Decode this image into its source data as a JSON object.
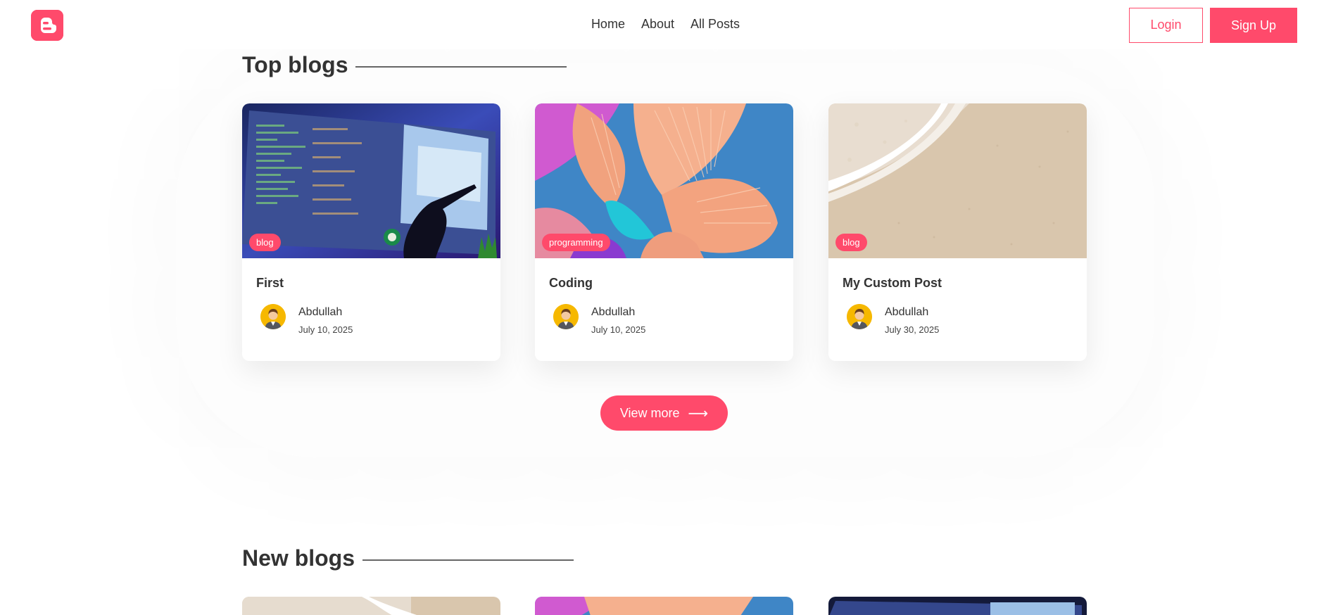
{
  "nav": {
    "links": [
      "Home",
      "About",
      "All Posts"
    ],
    "login_label": "Login",
    "signup_label": "Sign Up"
  },
  "sections": {
    "top_title": "Top blogs",
    "new_title": "New blogs"
  },
  "top_posts": [
    {
      "category": "blog",
      "title": "First",
      "author": "Abdullah",
      "date": "July 10, 2025",
      "image": "coding-screen"
    },
    {
      "category": "programming",
      "title": "Coding",
      "author": "Abdullah",
      "date": "July 10, 2025",
      "image": "abstract-coral"
    },
    {
      "category": "blog",
      "title": "My Custom Post",
      "author": "Abdullah",
      "date": "July 30, 2025",
      "image": "beach-sand"
    }
  ],
  "view_more_label": "View more",
  "new_posts": [
    {
      "image": "beach-sand"
    },
    {
      "image": "abstract-coral"
    },
    {
      "image": "coding-screen"
    }
  ],
  "colors": {
    "accent": "#ff4a6b",
    "text": "#333333"
  }
}
